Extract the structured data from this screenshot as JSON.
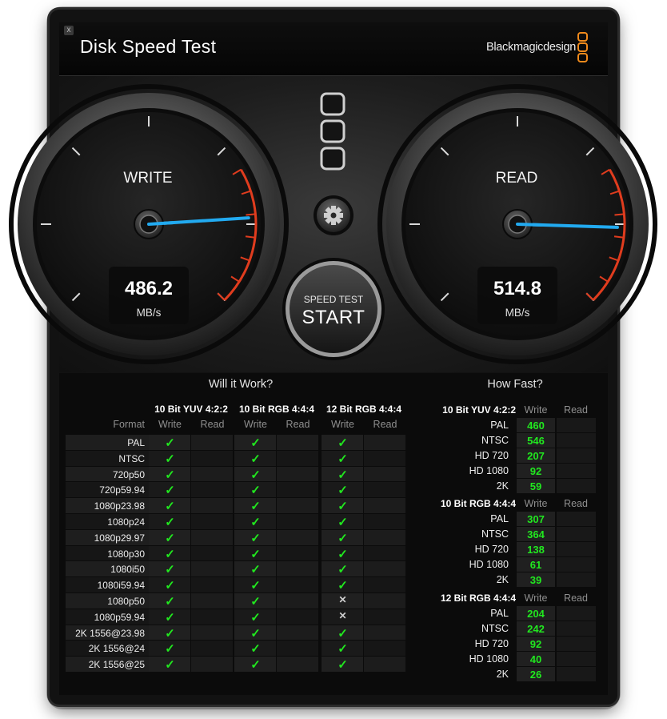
{
  "window": {
    "title": "Disk Speed Test",
    "brand": "Blackmagicdesign",
    "close_glyph": "x"
  },
  "write_gauge": {
    "label": "WRITE",
    "value": "486.2",
    "unit": "MB/s",
    "needle_fraction": 0.82
  },
  "read_gauge": {
    "label": "READ",
    "value": "514.8",
    "unit": "MB/s",
    "needle_fraction": 0.84
  },
  "controls": {
    "start_top": "SPEED TEST",
    "start_main": "START",
    "settings_icon": "gear-icon"
  },
  "colors": {
    "needle": "#22aaf0",
    "redline": "#e03c1e",
    "ok": "#21e81f",
    "logo": "#f08a1c"
  },
  "will_it_work": {
    "title": "Will it Work?",
    "format_header": "Format",
    "write_label": "Write",
    "read_label": "Read",
    "groups": [
      "10 Bit YUV 4:2:2",
      "10 Bit RGB 4:4:4",
      "12 Bit RGB 4:4:4"
    ],
    "rows": [
      {
        "format": "PAL",
        "ok": [
          true,
          true,
          true
        ]
      },
      {
        "format": "NTSC",
        "ok": [
          true,
          true,
          true
        ]
      },
      {
        "format": "720p50",
        "ok": [
          true,
          true,
          true
        ]
      },
      {
        "format": "720p59.94",
        "ok": [
          true,
          true,
          true
        ]
      },
      {
        "format": "1080p23.98",
        "ok": [
          true,
          true,
          true
        ]
      },
      {
        "format": "1080p24",
        "ok": [
          true,
          true,
          true
        ]
      },
      {
        "format": "1080p29.97",
        "ok": [
          true,
          true,
          true
        ]
      },
      {
        "format": "1080p30",
        "ok": [
          true,
          true,
          true
        ]
      },
      {
        "format": "1080i50",
        "ok": [
          true,
          true,
          true
        ]
      },
      {
        "format": "1080i59.94",
        "ok": [
          true,
          true,
          true
        ]
      },
      {
        "format": "1080p50",
        "ok": [
          true,
          true,
          false
        ]
      },
      {
        "format": "1080p59.94",
        "ok": [
          true,
          true,
          false
        ]
      },
      {
        "format": "2K 1556@23.98",
        "ok": [
          true,
          true,
          true
        ]
      },
      {
        "format": "2K 1556@24",
        "ok": [
          true,
          true,
          true
        ]
      },
      {
        "format": "2K 1556@25",
        "ok": [
          true,
          true,
          true
        ]
      }
    ]
  },
  "how_fast": {
    "title": "How Fast?",
    "write_label": "Write",
    "read_label": "Read",
    "groups": [
      {
        "name": "10 Bit YUV 4:2:2",
        "rows": [
          {
            "label": "PAL",
            "write": "460"
          },
          {
            "label": "NTSC",
            "write": "546"
          },
          {
            "label": "HD 720",
            "write": "207"
          },
          {
            "label": "HD 1080",
            "write": "92"
          },
          {
            "label": "2K",
            "write": "59"
          }
        ]
      },
      {
        "name": "10 Bit RGB 4:4:4",
        "rows": [
          {
            "label": "PAL",
            "write": "307"
          },
          {
            "label": "NTSC",
            "write": "364"
          },
          {
            "label": "HD 720",
            "write": "138"
          },
          {
            "label": "HD 1080",
            "write": "61"
          },
          {
            "label": "2K",
            "write": "39"
          }
        ]
      },
      {
        "name": "12 Bit RGB 4:4:4",
        "rows": [
          {
            "label": "PAL",
            "write": "204"
          },
          {
            "label": "NTSC",
            "write": "242"
          },
          {
            "label": "HD 720",
            "write": "92"
          },
          {
            "label": "HD 1080",
            "write": "40"
          },
          {
            "label": "2K",
            "write": "26"
          }
        ]
      }
    ]
  }
}
